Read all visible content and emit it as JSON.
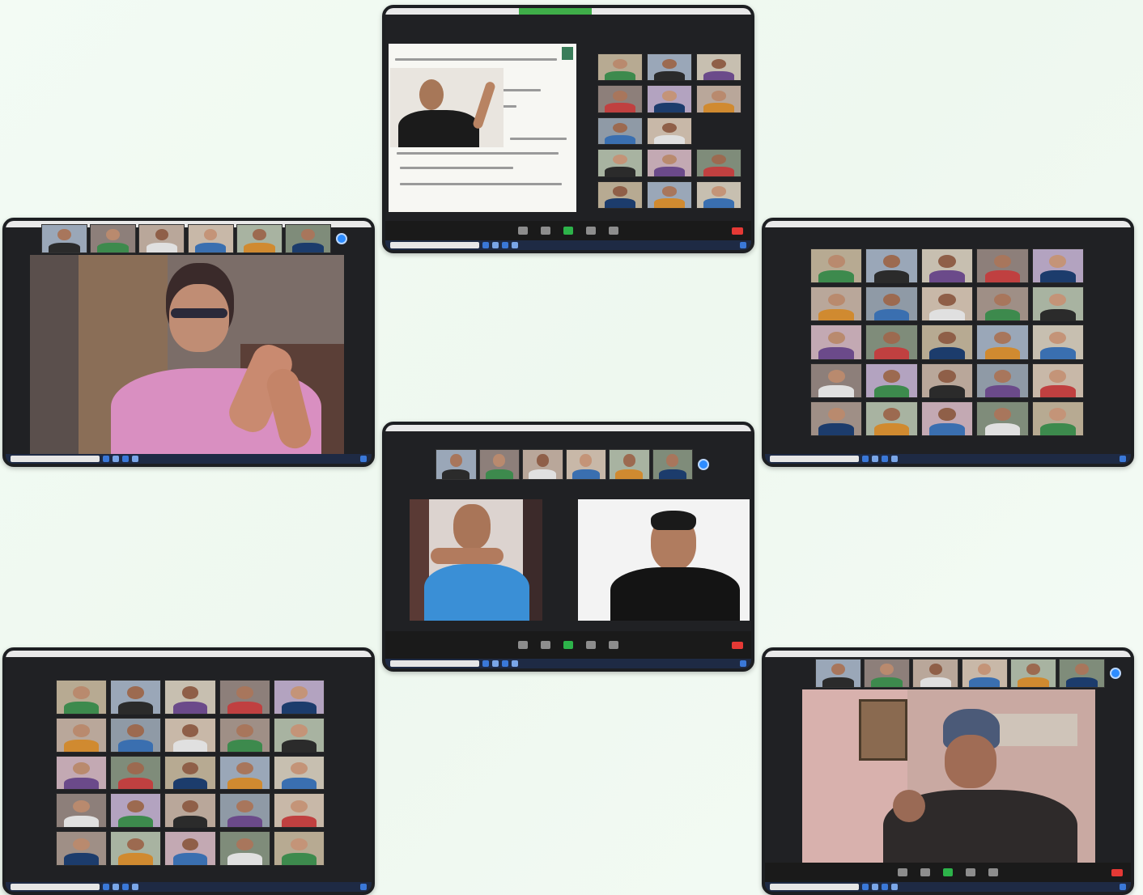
{
  "screenshots": [
    {
      "id": "slides-with-gallery",
      "layout": "slide-and-grid"
    },
    {
      "id": "speaker-woman",
      "layout": "speaker-view"
    },
    {
      "id": "gallery-top-right",
      "layout": "gallery-5x5"
    },
    {
      "id": "two-speakers",
      "layout": "two-up"
    },
    {
      "id": "gallery-bottom-left",
      "layout": "gallery-5x5"
    },
    {
      "id": "speaker-man-beanie",
      "layout": "speaker-view"
    }
  ],
  "colors": {
    "page_background": "#f1faf2",
    "window_frame": "#1d1f22",
    "meeting_background": "#202124",
    "control_bar": "#1a1a1a",
    "taskbar": "#1e2a44",
    "end_button": "#e53935",
    "active_green": "#2db34a",
    "avatar_blue": "#2d8cff"
  },
  "icons": {
    "end": "end-meeting-icon",
    "mic": "microphone-icon",
    "camera": "camera-icon",
    "share": "share-screen-icon",
    "participants": "participants-icon",
    "chat": "chat-icon"
  }
}
